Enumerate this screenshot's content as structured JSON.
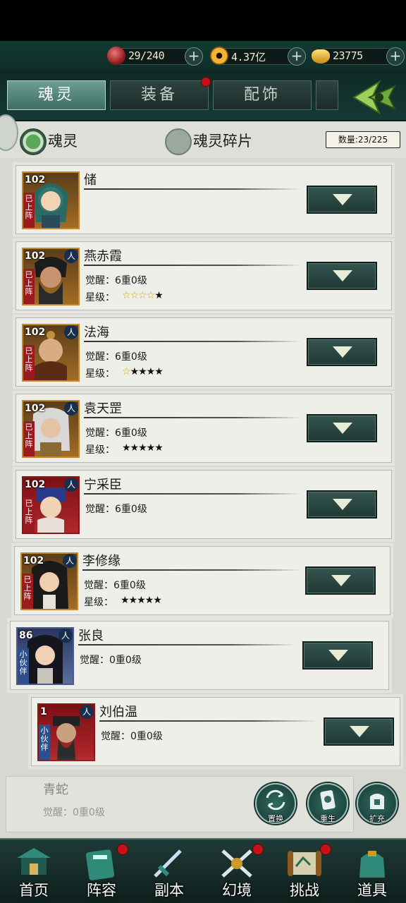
{
  "resources": {
    "soul_stones": "29/240",
    "coins": "4.37亿",
    "gold_ingots": "23775",
    "plus": "+"
  },
  "tabs": [
    {
      "label": "魂灵",
      "active": true
    },
    {
      "label": "装备",
      "active": false,
      "badge": true
    },
    {
      "label": "配饰",
      "active": false
    }
  ],
  "filters": {
    "option1": "魂灵",
    "option2": "魂灵碎片",
    "count": "数量:23/225"
  },
  "cards": [
    {
      "level": "102",
      "name": "储",
      "tag": "已上阵",
      "element": "",
      "awaken": "",
      "star_label": "",
      "stars": "",
      "stars_outline": ""
    },
    {
      "level": "102",
      "name": "燕赤霞",
      "tag": "已上阵",
      "element": "人",
      "awaken": "觉醒：6重0级",
      "star_label": "星级：",
      "stars_outline": "☆☆☆☆",
      "stars": "★"
    },
    {
      "level": "102",
      "name": "法海",
      "tag": "已上阵",
      "element": "人",
      "awaken": "觉醒：6重0级",
      "star_label": "星级：",
      "stars_outline": "☆",
      "stars": "★★★★"
    },
    {
      "level": "102",
      "name": "袁天罡",
      "tag": "已上阵",
      "element": "人",
      "awaken": "觉醒：6重0级",
      "star_label": "星级：",
      "stars_outline": "",
      "stars": "★★★★★"
    },
    {
      "level": "102",
      "name": "宁采臣",
      "tag": "已上阵",
      "element": "人",
      "awaken": "觉醒：6重0级",
      "star_label": "",
      "stars_outline": "",
      "stars": ""
    },
    {
      "level": "102",
      "name": "李修缘",
      "tag": "已上阵",
      "element": "人",
      "awaken": "觉醒：6重0级",
      "star_label": "星级：",
      "stars_outline": "",
      "stars": "★★★★★"
    },
    {
      "level": "86",
      "name": "张良",
      "tag": "小伙伴",
      "element": "人",
      "awaken": "觉醒：0重0级",
      "star_label": "",
      "stars_outline": "",
      "stars": ""
    },
    {
      "level": "1",
      "name": "刘伯温",
      "tag": "小伙伴",
      "element": "人",
      "awaken": "觉醒：0重0级",
      "star_label": "",
      "stars_outline": "",
      "stars": ""
    }
  ],
  "ghost_card": {
    "name": "青蛇",
    "awaken": "觉醒：0重0级"
  },
  "actions": {
    "replace": "置换",
    "rebirth": "重生",
    "expand": "扩充"
  },
  "nav": [
    {
      "label": "首页",
      "badge": false
    },
    {
      "label": "阵容",
      "badge": true
    },
    {
      "label": "副本",
      "badge": false
    },
    {
      "label": "幻境",
      "badge": true
    },
    {
      "label": "挑战",
      "badge": true
    },
    {
      "label": "道具",
      "badge": false
    }
  ],
  "colors": {
    "accent": "#3f6f64",
    "badge_red": "#c8101a",
    "gold": "#d89b1e"
  }
}
